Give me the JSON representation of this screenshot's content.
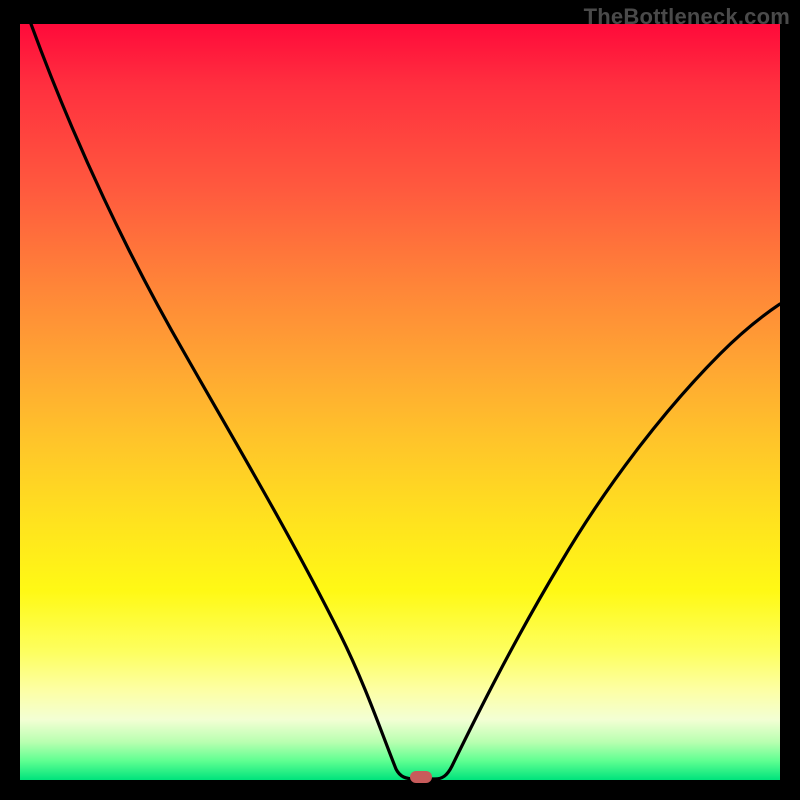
{
  "watermark": "TheBottleneck.com",
  "colors": {
    "page_bg": "#000000",
    "watermark": "#4a4a4a",
    "curve": "#000000",
    "marker": "#c75b5b",
    "gradient_top": "#ff0a3a",
    "gradient_bottom": "#00e37c"
  },
  "chart_data": {
    "type": "line",
    "title": "",
    "xlabel": "",
    "ylabel": "",
    "xlim": [
      0,
      100
    ],
    "ylim": [
      0,
      100
    ],
    "x": [
      0,
      5,
      10,
      15,
      20,
      25,
      30,
      35,
      40,
      45,
      48,
      50,
      52,
      54,
      56,
      60,
      65,
      70,
      75,
      80,
      85,
      90,
      95,
      100
    ],
    "values": [
      100,
      91,
      82,
      73,
      65,
      56,
      47,
      38,
      28,
      16,
      6,
      0,
      0,
      0,
      3,
      12,
      22,
      31,
      39,
      46,
      52,
      56,
      60,
      63
    ],
    "marker": {
      "x": 52,
      "y": 0
    },
    "annotations": []
  }
}
